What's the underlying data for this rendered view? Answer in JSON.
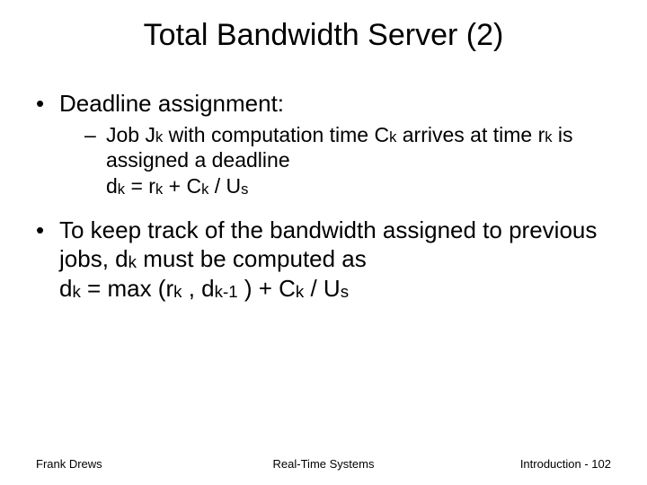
{
  "title": "Total Bandwidth Server (2)",
  "bullets": {
    "b1": {
      "label": "Deadline assignment:",
      "sub": {
        "s1": {
          "prefix": "Job J",
          "k1": "k",
          "mid1": " with computation time C",
          "k2": "k",
          "mid2": " arrives at time r",
          "k3": "k",
          "mid3": " is assigned a deadline",
          "line2_a": "d",
          "line2_k1": "k",
          "line2_b": " = r",
          "line2_k2": "k",
          "line2_c": " + C",
          "line2_k3": "k",
          "line2_d": " / U",
          "line2_k4": "s"
        }
      }
    },
    "b2": {
      "a": "To keep track of the bandwidth assigned to previous jobs, d",
      "k1": "k",
      "b": " must be computed as",
      "line2_a": "d",
      "line2_k1": "k",
      "line2_b": " = max (r",
      "line2_k2": "k",
      "line2_c": " , d",
      "line2_k3": "k-1",
      "line2_d": " ) + C",
      "line2_k4": "k",
      "line2_e": " / U",
      "line2_k5": "s"
    }
  },
  "footer": {
    "left": "Frank Drews",
    "center": "Real-Time Systems",
    "right": "Introduction - 102"
  }
}
